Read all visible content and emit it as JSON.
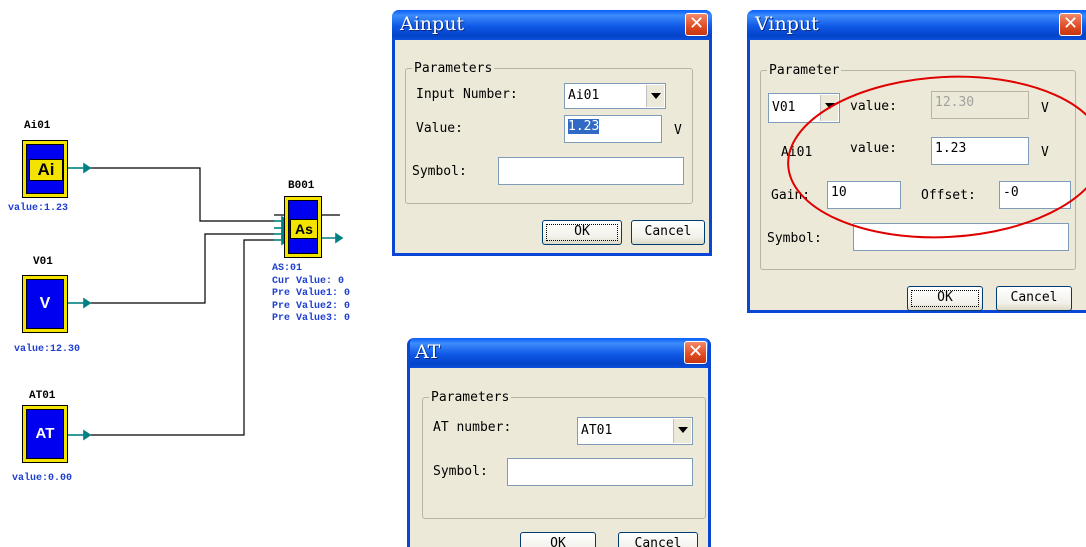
{
  "diagram": {
    "ai_block": {
      "title": "Ai01",
      "label": "Ai",
      "value": "value:1.23"
    },
    "v_block": {
      "title": "V01",
      "label": "V",
      "value": "value:12.30"
    },
    "at_block": {
      "title": "AT01",
      "label": "AT",
      "value": "value:0.00"
    },
    "as_block": {
      "title": "B001",
      "label": "As",
      "info": [
        "AS:01",
        "Cur Value: 0",
        "Pre Value1: 0",
        "Pre Value2: 0",
        "Pre Value3: 0"
      ]
    }
  },
  "ainput": {
    "title": "Ainput",
    "group": "Parameters",
    "input_number_label": "Input Number:",
    "input_number_value": "Ai01",
    "value_label": "Value:",
    "value": "1.23",
    "unit": "V",
    "symbol_label": "Symbol:",
    "symbol_value": "",
    "ok": "OK",
    "cancel": "Cancel"
  },
  "vinput": {
    "title": "Vinput",
    "group": "Parameter",
    "source_value": "V01",
    "value_label_1": "value:",
    "value_1": "12.30",
    "unit_1": "V",
    "ai_label": "Ai01",
    "value_label_2": "value:",
    "value_2": "1.23",
    "unit_2": "V",
    "gain_label": "Gain:",
    "gain_value": "10",
    "offset_label": "Offset:",
    "offset_value": "-0",
    "symbol_label": "Symbol:",
    "symbol_value": "",
    "ok": "OK",
    "cancel": "Cancel",
    "highlight_color": "#e00000"
  },
  "at_dialog": {
    "title": "AT",
    "group": "Parameters",
    "at_number_label": "AT number:",
    "at_number_value": "AT01",
    "symbol_label": "Symbol:",
    "symbol_value": "",
    "ok": "OK",
    "cancel": "Cancel"
  },
  "colors": {
    "titlebar": "#0a5ef6",
    "dialog_bg": "#ece9d8",
    "block_fill": "#0000f0",
    "block_frame": "#f3e400",
    "info_text": "#1f3fd0",
    "connector": "#008080"
  },
  "icons": {
    "close": "close-icon",
    "dropdown": "chevron-down-icon"
  }
}
